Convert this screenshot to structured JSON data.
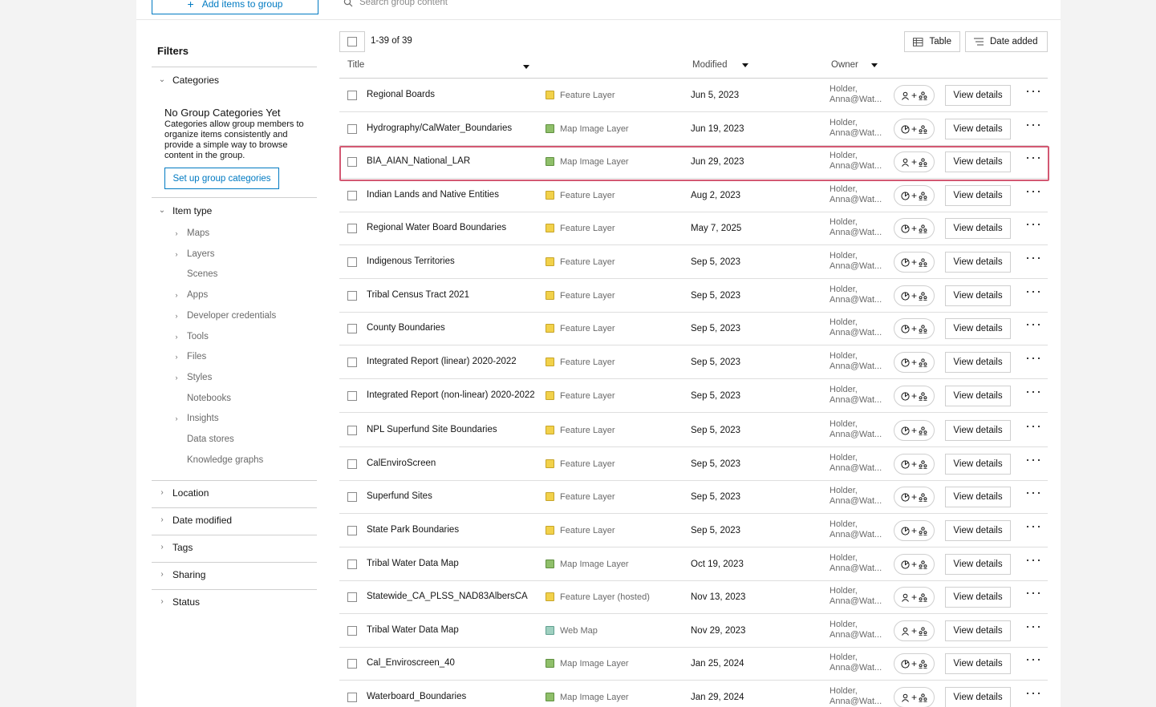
{
  "topbar": {
    "add_label": "Add items to group",
    "search_placeholder": "Search group content"
  },
  "filters": {
    "title": "Filters",
    "categories": {
      "label": "Categories",
      "empty_heading": "No Group Categories Yet",
      "description": "Categories allow group members to organize items consistently and provide a simple way to browse content in the group.",
      "setup_label": "Set up group categories"
    },
    "item_type": {
      "label": "Item type",
      "items": [
        {
          "label": "Maps",
          "expandable": true
        },
        {
          "label": "Layers",
          "expandable": true
        },
        {
          "label": "Scenes",
          "expandable": false
        },
        {
          "label": "Apps",
          "expandable": true
        },
        {
          "label": "Developer credentials",
          "expandable": true
        },
        {
          "label": "Tools",
          "expandable": true
        },
        {
          "label": "Files",
          "expandable": true
        },
        {
          "label": "Styles",
          "expandable": true
        },
        {
          "label": "Notebooks",
          "expandable": false
        },
        {
          "label": "Insights",
          "expandable": true
        },
        {
          "label": "Data stores",
          "expandable": false
        },
        {
          "label": "Knowledge graphs",
          "expandable": false
        }
      ]
    },
    "sections": [
      "Location",
      "Date modified",
      "Tags",
      "Sharing",
      "Status"
    ]
  },
  "list": {
    "count": "1-39 of 39",
    "table_label": "Table",
    "sort_label": "Date added",
    "columns": {
      "title": "Title",
      "modified": "Modified",
      "owner": "Owner"
    },
    "view_details_label": "View details",
    "rows": [
      {
        "title": "Regional Boards",
        "type": "Feature Layer",
        "icon": "feature-layer-icon",
        "modified": "Jun 5, 2023",
        "owner1": "Holder,",
        "owner2": "Anna@Wat...",
        "share": "user"
      },
      {
        "title": "Hydrography/CalWater_Boundaries",
        "type": "Map Image Layer",
        "icon": "map-image-layer-icon",
        "modified": "Jun 19, 2023",
        "owner1": "Holder,",
        "owner2": "Anna@Wat...",
        "share": "public"
      },
      {
        "title": "BIA_AIAN_National_LAR",
        "type": "Map Image Layer",
        "icon": "map-image-layer-icon",
        "modified": "Jun 29, 2023",
        "owner1": "Holder,",
        "owner2": "Anna@Wat...",
        "share": "user"
      },
      {
        "title": "Indian Lands and Native Entities",
        "type": "Feature Layer",
        "icon": "feature-layer-icon",
        "modified": "Aug 2, 2023",
        "owner1": "Holder,",
        "owner2": "Anna@Wat...",
        "share": "public"
      },
      {
        "title": "Regional Water Board Boundaries",
        "type": "Feature Layer",
        "icon": "feature-layer-icon",
        "modified": "May 7, 2025",
        "owner1": "Holder,",
        "owner2": "Anna@Wat...",
        "share": "public"
      },
      {
        "title": "Indigenous Territories",
        "type": "Feature Layer",
        "icon": "feature-layer-icon",
        "modified": "Sep 5, 2023",
        "owner1": "Holder,",
        "owner2": "Anna@Wat...",
        "share": "public"
      },
      {
        "title": "Tribal Census Tract 2021",
        "type": "Feature Layer",
        "icon": "feature-layer-icon",
        "modified": "Sep 5, 2023",
        "owner1": "Holder,",
        "owner2": "Anna@Wat...",
        "share": "public"
      },
      {
        "title": "County Boundaries",
        "type": "Feature Layer",
        "icon": "feature-layer-icon",
        "modified": "Sep 5, 2023",
        "owner1": "Holder,",
        "owner2": "Anna@Wat...",
        "share": "public"
      },
      {
        "title": "Integrated Report (linear) 2020-2022",
        "type": "Feature Layer",
        "icon": "feature-layer-icon",
        "modified": "Sep 5, 2023",
        "owner1": "Holder,",
        "owner2": "Anna@Wat...",
        "share": "public"
      },
      {
        "title": "Integrated Report (non-linear) 2020-2022",
        "type": "Feature Layer",
        "icon": "feature-layer-icon",
        "modified": "Sep 5, 2023",
        "owner1": "Holder,",
        "owner2": "Anna@Wat...",
        "share": "public"
      },
      {
        "title": "NPL Superfund Site Boundaries",
        "type": "Feature Layer",
        "icon": "feature-layer-icon",
        "modified": "Sep 5, 2023",
        "owner1": "Holder,",
        "owner2": "Anna@Wat...",
        "share": "public"
      },
      {
        "title": "CalEnviroScreen",
        "type": "Feature Layer",
        "icon": "feature-layer-icon",
        "modified": "Sep 5, 2023",
        "owner1": "Holder,",
        "owner2": "Anna@Wat...",
        "share": "public"
      },
      {
        "title": "Superfund Sites",
        "type": "Feature Layer",
        "icon": "feature-layer-icon",
        "modified": "Sep 5, 2023",
        "owner1": "Holder,",
        "owner2": "Anna@Wat...",
        "share": "public"
      },
      {
        "title": "State Park Boundaries",
        "type": "Feature Layer",
        "icon": "feature-layer-icon",
        "modified": "Sep 5, 2023",
        "owner1": "Holder,",
        "owner2": "Anna@Wat...",
        "share": "public"
      },
      {
        "title": "Tribal Water Data Map",
        "type": "Map Image Layer",
        "icon": "map-image-layer-icon",
        "modified": "Oct 19, 2023",
        "owner1": "Holder,",
        "owner2": "Anna@Wat...",
        "share": "public"
      },
      {
        "title": "Statewide_CA_PLSS_NAD83AlbersCA",
        "type": "Feature Layer (hosted)",
        "icon": "feature-layer-hosted-icon",
        "modified": "Nov 13, 2023",
        "owner1": "Holder,",
        "owner2": "Anna@Wat...",
        "share": "user"
      },
      {
        "title": "Tribal Water Data Map",
        "type": "Web Map",
        "icon": "web-map-icon",
        "modified": "Nov 29, 2023",
        "owner1": "Holder,",
        "owner2": "Anna@Wat...",
        "share": "user"
      },
      {
        "title": "Cal_Enviroscreen_40",
        "type": "Map Image Layer",
        "icon": "map-image-layer-icon",
        "modified": "Jan 25, 2024",
        "owner1": "Holder,",
        "owner2": "Anna@Wat...",
        "share": "public"
      },
      {
        "title": "Waterboard_Boundaries",
        "type": "Map Image Layer",
        "icon": "map-image-layer-icon",
        "modified": "Jan 29, 2024",
        "owner1": "Holder,",
        "owner2": "Anna@Wat...",
        "share": "user"
      }
    ],
    "highlighted_row": 2
  },
  "colors": {
    "accent": "#007ac2",
    "highlight": "#d35872",
    "feature_layer": "#f2d14a",
    "map_image_layer": "#8fbf6a"
  }
}
